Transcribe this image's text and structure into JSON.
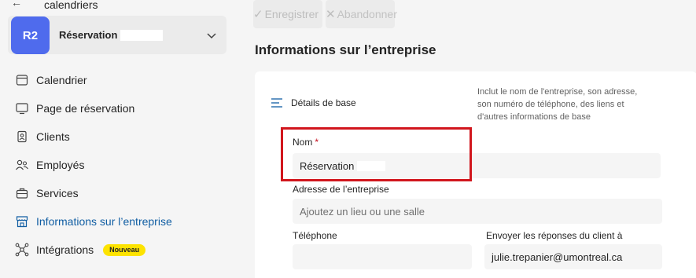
{
  "header": {
    "back_label": "calendriers"
  },
  "business": {
    "initials": "R2",
    "name": "Réservation"
  },
  "nav": {
    "items": [
      {
        "label": "Calendrier",
        "icon": "calendar-icon"
      },
      {
        "label": "Page de réservation",
        "icon": "monitor-icon"
      },
      {
        "label": "Clients",
        "icon": "contact-card-icon"
      },
      {
        "label": "Employés",
        "icon": "people-icon"
      },
      {
        "label": "Services",
        "icon": "briefcase-icon"
      },
      {
        "label": "Informations sur l’entreprise",
        "icon": "building-shop-icon",
        "active": true
      },
      {
        "label": "Intégrations",
        "icon": "integrations-icon",
        "badge": "Nouveau"
      }
    ]
  },
  "toolbar": {
    "save_label": "Enregistrer",
    "cancel_label": "Abandonner"
  },
  "page": {
    "title": "Informations sur l’entreprise"
  },
  "section": {
    "title": "Détails de base",
    "description": "Inclut le nom de l'entreprise, son adresse, son numéro de téléphone, des liens et d'autres informations de base"
  },
  "form": {
    "name_label": "Nom",
    "name_required_mark": "*",
    "name_value": "Réservation",
    "address_label": "Adresse de l’entreprise",
    "address_placeholder": "Ajoutez un lieu ou une salle",
    "phone_label": "Téléphone",
    "phone_value": "",
    "reply_label": "Envoyer les réponses du client à",
    "reply_value": "julie.trepanier@umontreal.ca"
  },
  "colors": {
    "accent": "#4f6bed",
    "active_nav": "#115ea3",
    "badge": "#fde300",
    "highlight": "#d1161d",
    "required": "#c50f1f"
  }
}
